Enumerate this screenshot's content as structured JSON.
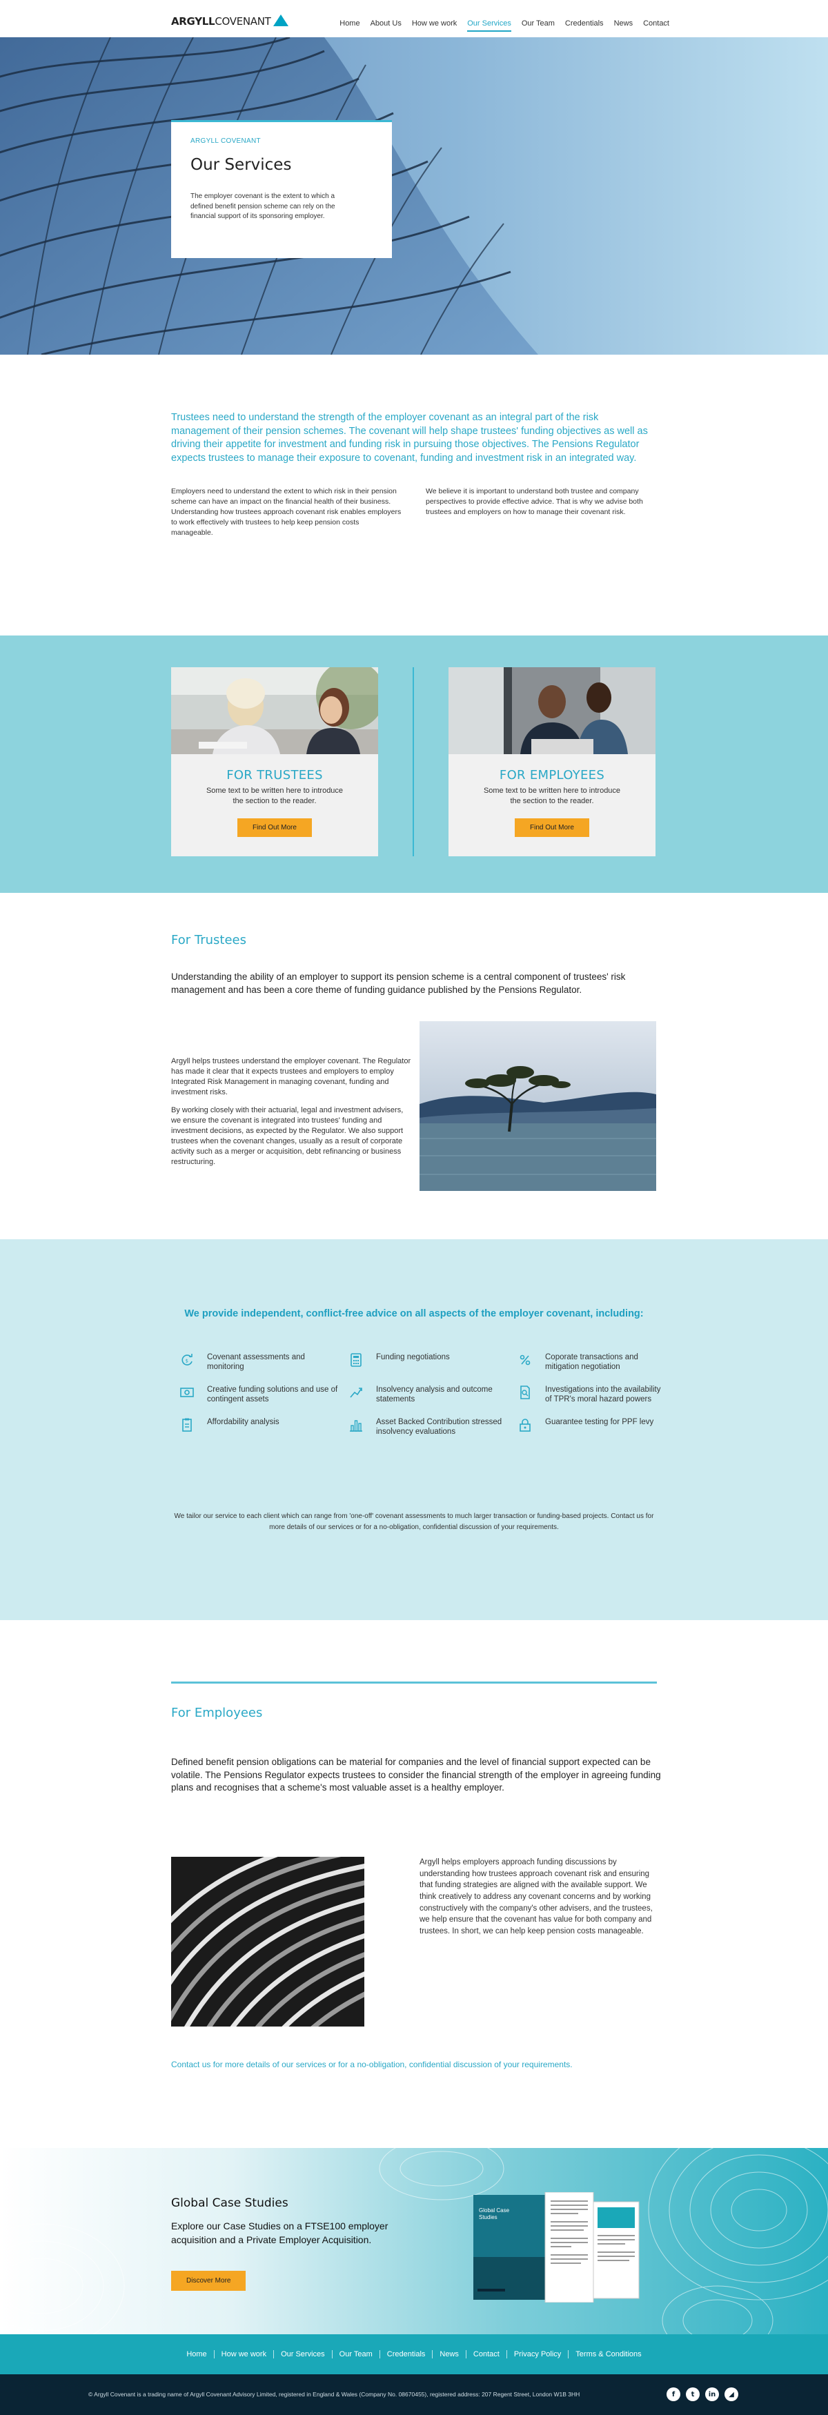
{
  "header": {
    "logo_bold": "ARGYLL",
    "logo_rest": "COVENANT",
    "nav": [
      {
        "label": "Home"
      },
      {
        "label": "About Us"
      },
      {
        "label": "How we work"
      },
      {
        "label": "Our Services",
        "active": true
      },
      {
        "label": "Our Team"
      },
      {
        "label": "Credentials"
      },
      {
        "label": "News"
      },
      {
        "label": "Contact"
      }
    ]
  },
  "hero": {
    "eyebrow": "ARGYLL COVENANT",
    "title": "Our Services",
    "text": "The employer covenant is the extent to which a defined benefit pension scheme can rely on the financial support of its sponsoring employer."
  },
  "intro": {
    "lead": "Trustees need to understand the strength of the employer covenant as an integral part of the risk management of their pension schemes. The covenant will help shape trustees' funding objectives as well as driving their appetite for investment and funding risk in pursuing those objectives. The Pensions Regulator expects trustees to manage their exposure to covenant, funding and investment risk in an integrated way.",
    "col_left": "Employers need to understand the extent to which risk in their pension scheme can have an impact on the financial health of their business. Understanding how trustees approach covenant risk enables employers to work effectively with trustees to help keep pension costs manageable.",
    "col_right": "We believe it is important to understand both trustee and company perspectives to provide effective advice. That is why we advise both trustees and employers on how to manage their covenant risk."
  },
  "audience": {
    "trustees": {
      "title": "FOR TRUSTEES",
      "text": "Some text to be written here to introduce the section to the reader.",
      "button": "Find Out More"
    },
    "employees": {
      "title": "FOR EMPLOYEES",
      "text": "Some text to be written here to introduce the section to the reader.",
      "button": "Find Out More"
    }
  },
  "trustees": {
    "title": "For Trustees",
    "lead": "Understanding the ability of an employer to support its pension scheme is a central component of trustees' risk management and has been a core theme of funding guidance published by the Pensions Regulator.",
    "p1": "Argyll helps trustees understand the employer covenant. The Regulator has made it clear that it expects trustees and employers to employ Integrated Risk Management in managing covenant, funding and investment risks.",
    "p2": "By working closely with their actuarial, legal and investment advisers, we ensure the covenant is integrated into trustees' funding and investment decisions, as expected by the Regulator. We also support trustees when the covenant changes, usually as a result of corporate activity such as a merger or acquisition, debt refinancing or business restructuring."
  },
  "services": {
    "heading": "We provide independent, conflict-free advice on all aspects of the employer covenant, including:",
    "items": [
      {
        "label": "Covenant assessments and monitoring",
        "icon": "refresh-icon"
      },
      {
        "label": "Funding negotiations",
        "icon": "calculator-icon"
      },
      {
        "label": "Coporate transactions and mitigation negotiation",
        "icon": "percent-icon"
      },
      {
        "label": "Creative funding solutions and use of contingent assets",
        "icon": "banknote-icon"
      },
      {
        "label": "Insolvency analysis and outcome statements",
        "icon": "trend-line-icon"
      },
      {
        "label": "Investigations into the availability of TPR's moral hazard powers",
        "icon": "document-search-icon"
      },
      {
        "label": "Affordability analysis",
        "icon": "clipboard-icon"
      },
      {
        "label": "Asset Backed Contribution stressed insolvency evaluations",
        "icon": "bar-chart-icon"
      },
      {
        "label": "Guarantee testing for PPF levy",
        "icon": "lock-icon"
      }
    ],
    "footnote": "We tailor our service to each client which can range from 'one-off' covenant assessments to much larger transaction or funding-based projects.  Contact us for more details of our services or for a no-obligation, confidential discussion of your requirements."
  },
  "employees": {
    "title": "For Employees",
    "lead": "Defined benefit pension obligations can be material for companies and the level of financial support expected can be volatile.  The Pensions Regulator expects trustees to consider the financial strength of the employer in agreeing funding plans and recognises that a scheme's most valuable asset is a healthy employer.",
    "body": "Argyll helps employers approach funding discussions by understanding how trustees approach covenant risk and ensuring that funding strategies are aligned with the available support.  We think creatively to address any covenant concerns and by working constructively with the company's other advisers, and the trustees, we help ensure that the covenant has value for both company and trustees. In short, we can help keep pension costs manageable.",
    "contact": "Contact us for more details of our services or for a no-obligation, confidential discussion of your requirements."
  },
  "case_studies": {
    "title": "Global Case Studies",
    "text": "Explore our Case Studies on a FTSE100 employer acquisition and a Private Employer Acquisition.",
    "button": "Discover More",
    "brochure_title": "Global Case Studies"
  },
  "footer": {
    "nav": [
      "Home",
      "How we work",
      "Our Services",
      "Our Team",
      "Credentials",
      "News",
      "Contact",
      "Privacy Policy",
      "Terms & Conditions"
    ],
    "legal": "© Argyll Covenant is a trading name of Argyll Covenant Advisory Limited, registered in England & Wales (Company No. 08670455), registered address: 207 Regent Street, London W1B 3HH",
    "socials": [
      {
        "icon": "facebook-icon",
        "glyph": "f"
      },
      {
        "icon": "twitter-icon",
        "glyph": "t"
      },
      {
        "icon": "linkedin-icon",
        "glyph": "in"
      },
      {
        "icon": "rss-icon",
        "glyph": "◢"
      }
    ]
  },
  "colors": {
    "accent": "#2aa8c6",
    "button": "#f5a623",
    "band": "#8dd3dd",
    "services_bg": "#cdebf0",
    "footer_nav": "#1aa8b8",
    "footer_legal": "#0a2434"
  }
}
